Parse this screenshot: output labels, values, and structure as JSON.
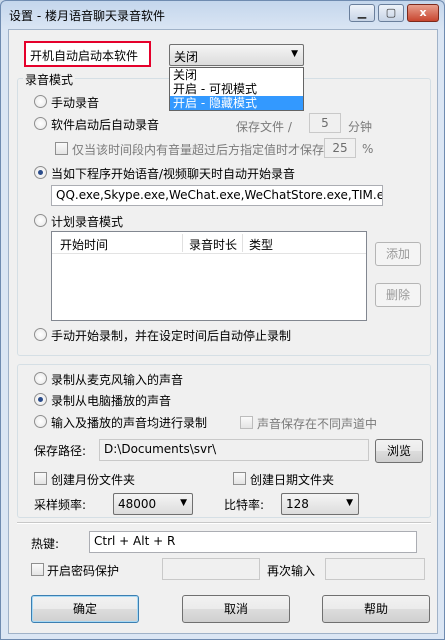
{
  "window": {
    "title": "设置 - 楼月语音聊天录音软件",
    "minimize_glyph": "▁",
    "maximize_glyph": "▢",
    "close_glyph": "x"
  },
  "autostart": {
    "label": "开机自动启动本软件",
    "selected": "关闭",
    "options": [
      "关闭",
      "开启 - 可视模式",
      "开启 - 隐藏模式"
    ],
    "highlighted_index": 2
  },
  "record_mode": {
    "group_label": "录音模式",
    "manual": "手动录音",
    "after_start": "软件启动后自动录音",
    "save_every_label": "保存文件 /",
    "save_every_value": "5",
    "save_every_unit": "分钟",
    "silence_label": "仅当该时间段内有音量超过后方指定值时才保存",
    "silence_value": "25",
    "silence_unit": "%",
    "auto_on_chat": "当如下程序开始语音/视频聊天时自动开始录音",
    "programs": "QQ.exe,Skype.exe,WeChat.exe,WeChatStore.exe,TIM.exe",
    "scheduled": "计划录音模式",
    "columns": [
      "开始时间",
      "录音时长",
      "类型"
    ],
    "add_button": "添加",
    "delete_button": "删除",
    "manual_timed": "手动开始录制，并在设定时间后自动停止录制",
    "selected_option": "auto_on_chat"
  },
  "source": {
    "mic": "录制从麦克风输入的声音",
    "speaker": "录制从电脑播放的声音",
    "both": "输入及播放的声音均进行录制",
    "separate_channels": "声音保存在不同声道中",
    "selected_option": "speaker"
  },
  "storage": {
    "path_label": "保存路径:",
    "path_value": "D:\\Documents\\svr\\",
    "browse_button": "浏览",
    "monthly_folder": "创建月份文件夹",
    "daily_folder": "创建日期文件夹",
    "sample_rate_label": "采样频率:",
    "sample_rate_value": "48000",
    "bitrate_label": "比特率:",
    "bitrate_value": "128"
  },
  "hotkey": {
    "label": "热键:",
    "value": "Ctrl + Alt + R"
  },
  "password": {
    "enable_label": "开启密码保护",
    "confirm_label": "再次输入"
  },
  "buttons": {
    "ok": "确定",
    "cancel": "取消",
    "help": "帮助"
  }
}
